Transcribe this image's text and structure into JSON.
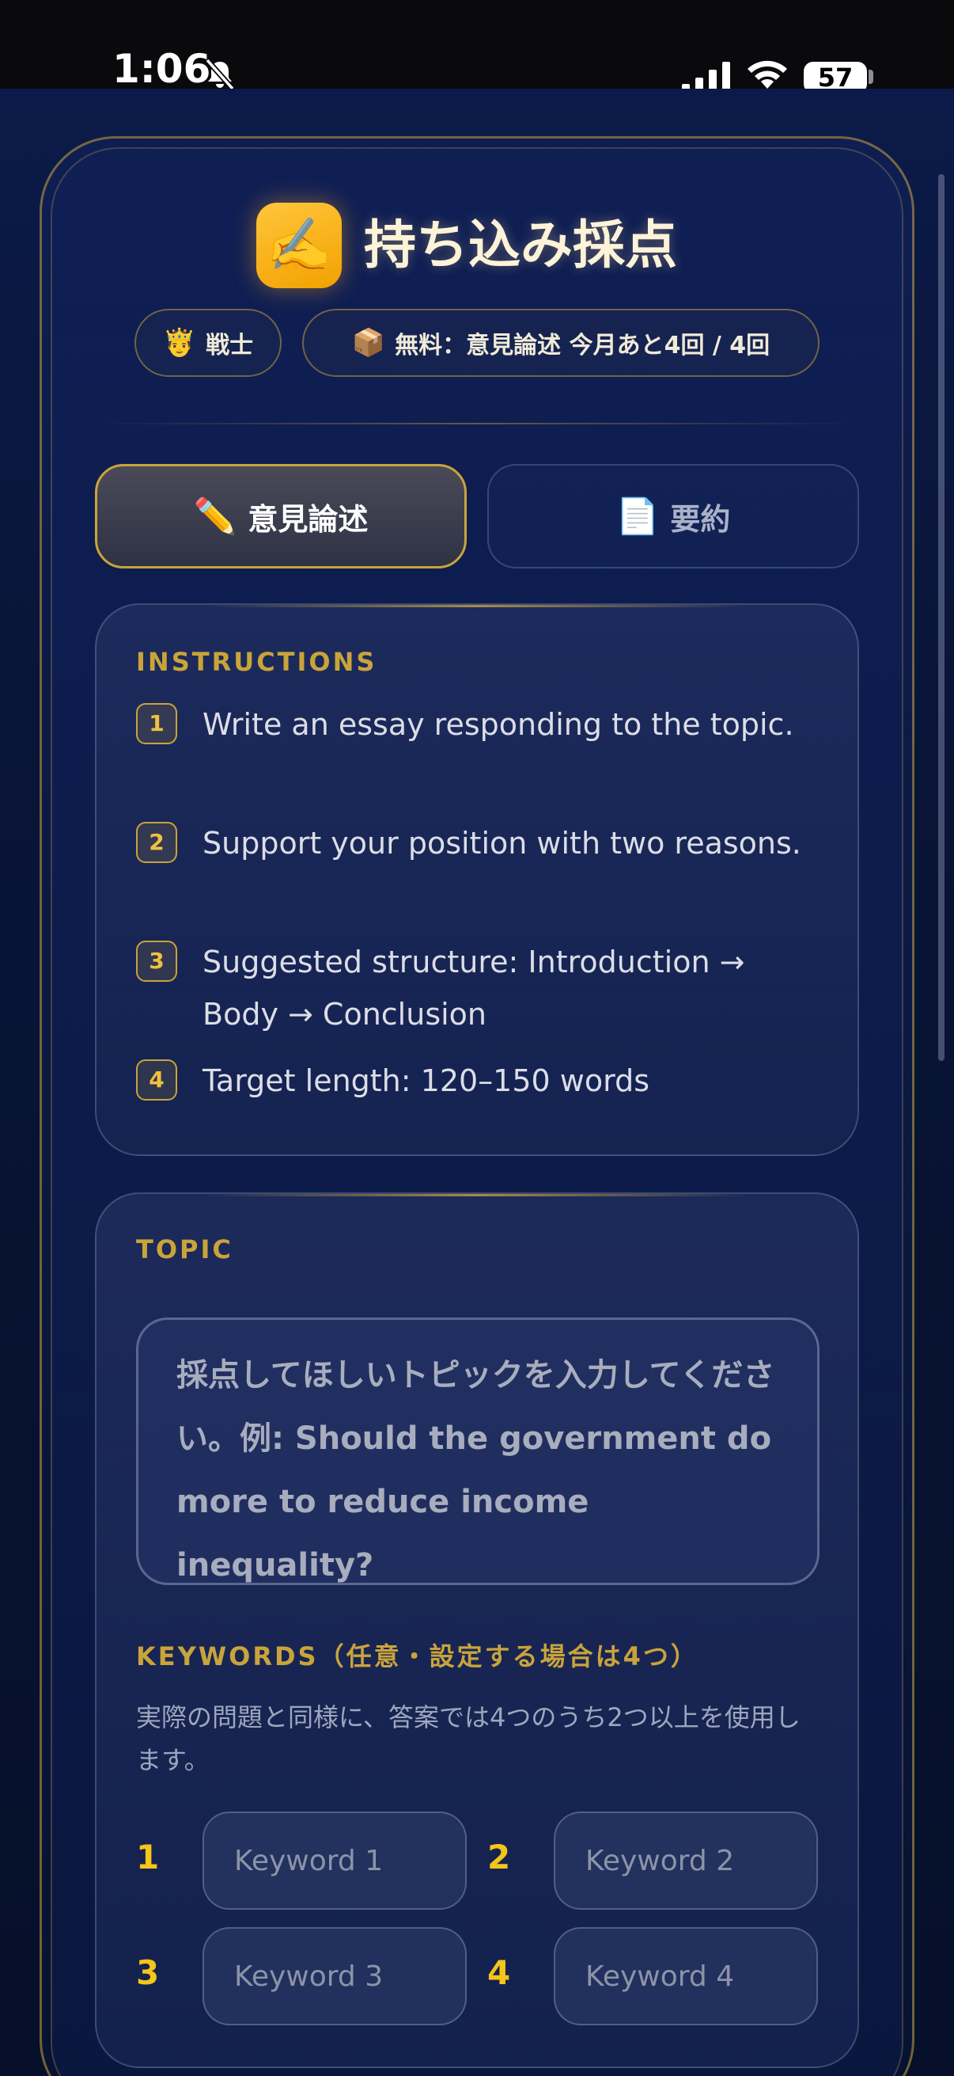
{
  "status_bar": {
    "time": "1:06",
    "battery": "57"
  },
  "header": {
    "icon": "✍️",
    "title": "持ち込み採点",
    "rank_badge": {
      "icon": "🤴",
      "label": "戦士"
    },
    "quota_badge": {
      "icon": "📦",
      "label": "無料：意見論述 今月あと4回 / 4回"
    }
  },
  "tabs": [
    {
      "icon": "✏️",
      "label": "意見論述",
      "active": true
    },
    {
      "icon": "📄",
      "label": "要約",
      "active": false
    }
  ],
  "instructions": {
    "heading": "INSTRUCTIONS",
    "steps": [
      {
        "num": "1",
        "text": "Write an essay responding to the topic."
      },
      {
        "num": "2",
        "text": "Support your position with two reasons."
      },
      {
        "num": "3",
        "text": "Suggested structure: Introduction → Body → Conclusion"
      },
      {
        "num": "4",
        "text": "Target length: 120–150 words"
      }
    ]
  },
  "topic": {
    "heading": "TOPIC",
    "placeholder": "採点してほしいトピックを入力してください。例: Should the government do more to reduce income inequality?"
  },
  "keywords": {
    "heading": "KEYWORDS（任意・設定する場合は4つ）",
    "help": "実際の問題と同様に、答案では4つのうち2つ以上を使用します。",
    "fields": [
      {
        "num": "1",
        "placeholder": "Keyword 1"
      },
      {
        "num": "2",
        "placeholder": "Keyword 2"
      },
      {
        "num": "3",
        "placeholder": "Keyword 3"
      },
      {
        "num": "4",
        "placeholder": "Keyword 4"
      }
    ]
  },
  "colors": {
    "accent_gold": "#c9a43a",
    "keyword_number": "#f5c518",
    "background": "#0b1a48"
  }
}
